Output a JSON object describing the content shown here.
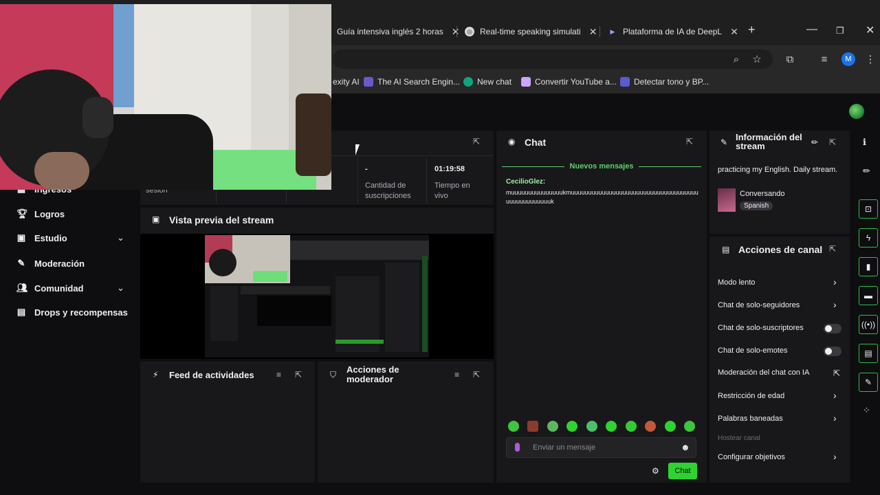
{
  "browser": {
    "tabs": [
      {
        "label": "Guía intensiva inglés 2 horas",
        "close": "✕"
      },
      {
        "label": "Real-time speaking simulati",
        "close": "✕"
      },
      {
        "label": "Plataforma de IA de DeepL",
        "close": "✕"
      }
    ],
    "new_tab": "+",
    "bookmarks": [
      {
        "label": "exity AI",
        "color": "#20808d"
      },
      {
        "label": "The AI Search Engin...",
        "color": "#6e56cf"
      },
      {
        "label": "New chat",
        "color": "#10a37f"
      },
      {
        "label": "Convertir YouTube a...",
        "color": "#8b5cf6"
      },
      {
        "label": "Detectar tono y BP...",
        "color": "#5b5bd6"
      }
    ],
    "profile_initial": "M"
  },
  "nav": {
    "items": [
      {
        "label": "Ingresos"
      },
      {
        "label": "Logros"
      },
      {
        "label": "Estudio"
      },
      {
        "label": "Moderación"
      },
      {
        "label": "Comunidad"
      },
      {
        "label": "Drops y recompensas"
      }
    ]
  },
  "stats": {
    "partial_label": "sesión",
    "subs_value": "-",
    "subs_label": "Cantidad de suscripciones",
    "time_value": "01:19:58",
    "time_label": "Tiempo en vivo"
  },
  "preview": {
    "title": "Vista previa del stream"
  },
  "feed": {
    "title": "Feed de actividades"
  },
  "modactions": {
    "title": "Acciones de moderador"
  },
  "chat": {
    "title": "Chat",
    "new_messages": "Nuevos mensajes",
    "user": "CecilioGlez:",
    "message": "muuuuuuuuuuuuuuukmuuuuuuuuuuuuuuuuuuuuuuuuuuuuuuuuuuuuuuuuuuuuuuuuuuk",
    "placeholder": "Enviar un mensaje",
    "send_label": "Chat"
  },
  "stream_info": {
    "title": "Información del stream",
    "description": "practicing my English. Daily stream.",
    "category": "Conversando",
    "tag": "Spanish"
  },
  "channel_actions": {
    "title": "Acciones de canal",
    "items": [
      {
        "label": "Modo lento"
      },
      {
        "label": "Chat de solo-seguidores"
      },
      {
        "label": "Chat de solo-suscriptores"
      },
      {
        "label": "Chat de solo-emotes"
      },
      {
        "label": "Moderación del chat con IA"
      },
      {
        "label": "Restricción de edad"
      },
      {
        "label": "Palabras baneadas"
      },
      {
        "label": "Hostear canal"
      },
      {
        "label": "Configurar objetivos"
      }
    ]
  },
  "colors": {
    "accent": "#2fd32f",
    "panel": "#18181b",
    "bg": "#0e0e10"
  }
}
